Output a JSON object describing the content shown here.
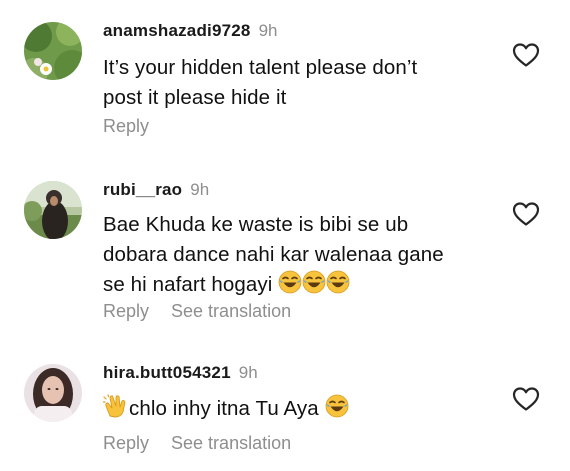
{
  "comments": [
    {
      "username": "anamshazadi9728",
      "time": "9h",
      "lines": [
        "It’s your hidden talent please don’t",
        "post it please hide it"
      ],
      "reply": "Reply"
    },
    {
      "username": "rubi__rao",
      "time": "9h",
      "lines": [
        "Bae Khuda ke waste is bibi se ub",
        "dobara dance nahi kar walenaa gane",
        "se hi nafart hogayi"
      ],
      "reply": "Reply",
      "translate": "See translation"
    },
    {
      "username": "hira.butt054321",
      "time": "9h",
      "lines": [
        "chlo inhy itna Tu Aya"
      ],
      "reply": "Reply",
      "translate": "See translation"
    }
  ],
  "icons": {
    "like": "heart-outline-icon",
    "laugh": "face-with-tears-of-joy-emoji",
    "clap": "clapping-hands-emoji"
  },
  "colors": {
    "text": "#111111",
    "muted": "#8e8e8e",
    "emoji_yellow": "#f7c33c"
  }
}
